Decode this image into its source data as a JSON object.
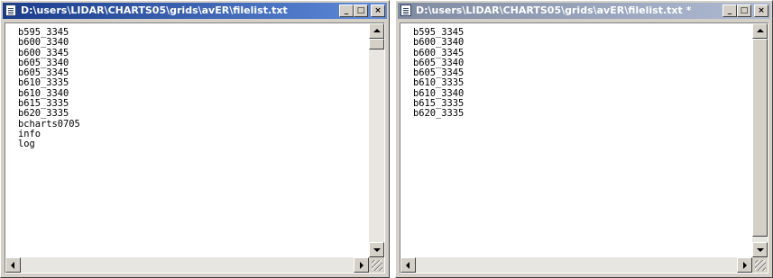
{
  "window_left": {
    "title": "D:\\users\\LIDAR\\CHARTS05\\grids\\avER\\filelist.txt",
    "lines": [
      "b595_3345",
      "b600_3340",
      "b600_3345",
      "b605_3340",
      "b605_3345",
      "b610_3335",
      "b610_3340",
      "b615_3335",
      "b620_3335",
      "bcharts0705",
      "info",
      "log"
    ]
  },
  "window_right": {
    "title": "D:\\users\\LIDAR\\CHARTS05\\grids\\avER\\filelist.txt *",
    "lines": [
      "b595_3345",
      "b600_3340",
      "b600_3345",
      "b605_3340",
      "b605_3345",
      "b610_3335",
      "b610_3340",
      "b615_3335",
      "b620_3335"
    ]
  },
  "controls": {
    "minimize": "_",
    "maximize": "□",
    "close": "×"
  },
  "icons": [
    "notepad-icon",
    "minimize-icon",
    "maximize-icon",
    "close-icon",
    "scroll-up-icon",
    "scroll-down-icon",
    "scroll-left-icon",
    "scroll-right-icon",
    "resize-grip-icon"
  ]
}
